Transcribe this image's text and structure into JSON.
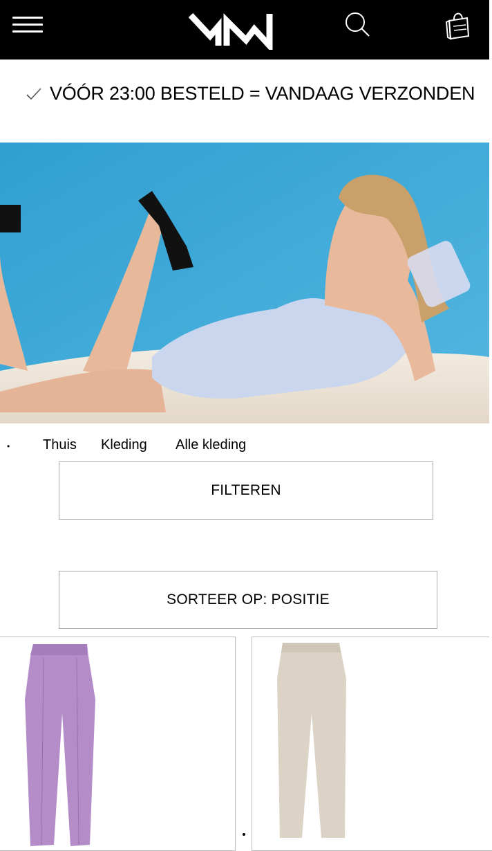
{
  "header": {
    "menu_icon": "hamburger-icon",
    "logo_text": "MW",
    "search_icon": "search-icon",
    "bag_icon": "shopping-bag-icon",
    "background": "#000000"
  },
  "notice": {
    "icon": "checkmark-icon",
    "text": "VÓÓR 23:00 BESTELD = VANDAAG VERZONDEN"
  },
  "hero": {
    "description_colors": {
      "backdrop": "#3aa6d6",
      "dress": "#c9d6ee",
      "floor": "#efe8df"
    }
  },
  "breadcrumb": {
    "items": [
      "Thuis",
      "Kleding",
      "Alle kleding"
    ]
  },
  "controls": {
    "filter_label": "FILTEREN",
    "sort_label": "SORTEER OP: POSITIE"
  },
  "products": [
    {
      "color": "#b48cc8"
    },
    {
      "color": "#dcd3c6"
    }
  ]
}
